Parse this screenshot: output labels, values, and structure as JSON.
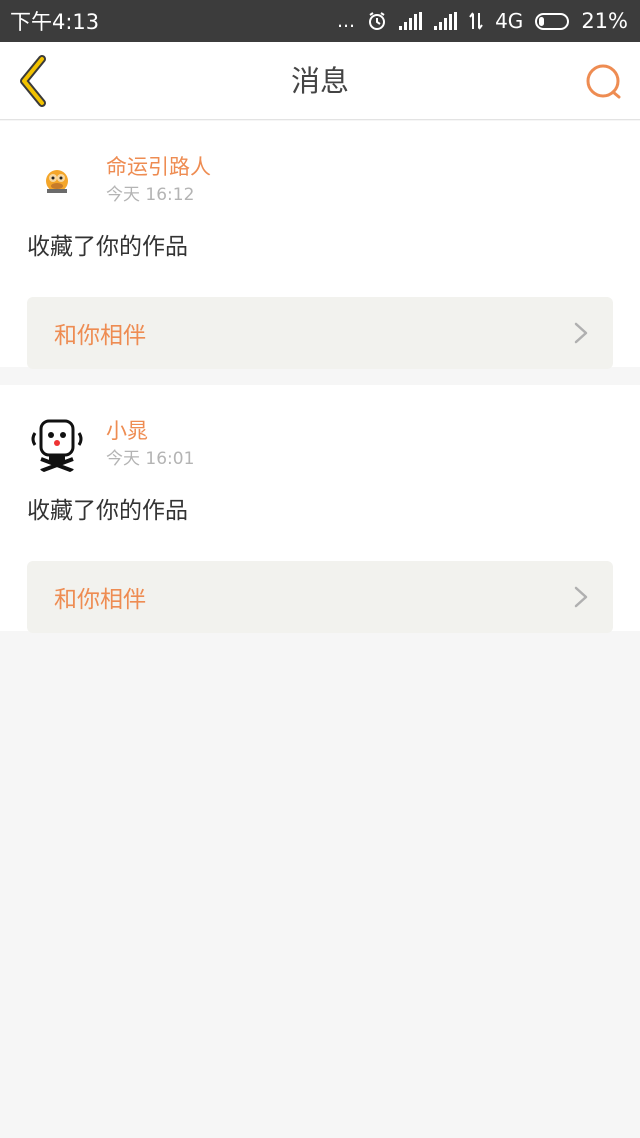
{
  "status_bar": {
    "time": "下午4:13",
    "dots": "...",
    "network": "4G",
    "battery_level": 0.21,
    "battery_text": "21%"
  },
  "nav": {
    "title": "消息",
    "accent_color": "#ee8c52"
  },
  "messages": [
    {
      "username": "命运引路人",
      "time": "今天 16:12",
      "action": "收藏了你的作品",
      "work_title": "和你相伴"
    },
    {
      "username": "小晁",
      "time": "今天 16:01",
      "action": "收藏了你的作品",
      "work_title": "和你相伴"
    }
  ]
}
